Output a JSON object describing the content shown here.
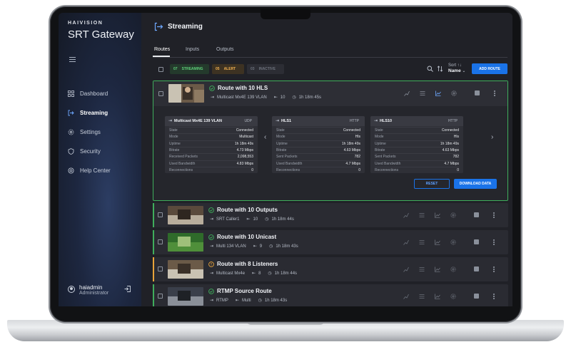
{
  "brand": {
    "top": "HAIVISION",
    "name": "SRT Gateway"
  },
  "sidebar": {
    "items": [
      {
        "label": "Dashboard",
        "icon": "dashboard-icon"
      },
      {
        "label": "Streaming",
        "icon": "streaming-icon",
        "active": true
      },
      {
        "label": "Settings",
        "icon": "gear-icon"
      },
      {
        "label": "Security",
        "icon": "shield-icon"
      },
      {
        "label": "Help Center",
        "icon": "help-icon"
      }
    ],
    "user": {
      "name": "haiadmin",
      "role": "Administrator"
    }
  },
  "page": {
    "title": "Streaming"
  },
  "tabs": [
    "Routes",
    "Inputs",
    "Outputs"
  ],
  "filters": {
    "streaming": {
      "count": "07",
      "label": "STREAMING"
    },
    "alert": {
      "count": "05",
      "label": "ALERT"
    },
    "inactive": {
      "count": "03",
      "label": "INACTIVE"
    }
  },
  "sort": {
    "label": "Sort ↑↓",
    "value": "Name"
  },
  "add_route_label": "ADD ROUTE",
  "expanded_route": {
    "name": "Route with 10 HLS",
    "source": "Multicast Mx4E 139 VLAN",
    "outputs": "10",
    "uptime": "1h 18m 45s",
    "panels": [
      {
        "title": "Multicast Mx4E 139 VLAN",
        "type": "UDP",
        "rows": [
          [
            "State",
            "Connected"
          ],
          [
            "Mode",
            "Multicast"
          ],
          [
            "Uptime",
            "1h 18m 49s"
          ],
          [
            "Bitrate",
            "4.73 Mbps"
          ],
          [
            "Received Packets",
            "2,098,553"
          ],
          [
            "Used Bandwidth",
            "4.83 Mbps"
          ],
          [
            "Reconnections",
            "0"
          ]
        ]
      },
      {
        "title": "HLS1",
        "type": "HTTP",
        "rows": [
          [
            "State",
            "Connected"
          ],
          [
            "Mode",
            "Hls"
          ],
          [
            "Uptime",
            "1h 18m 49s"
          ],
          [
            "Bitrate",
            "4.63 Mbps"
          ],
          [
            "Sent Packets",
            "782"
          ],
          [
            "Used Bandwidth",
            "4.7 Mbps"
          ],
          [
            "Reconnections",
            "0"
          ]
        ]
      },
      {
        "title": "HLS10",
        "type": "HTTP",
        "rows": [
          [
            "State",
            "Connected"
          ],
          [
            "Mode",
            "Hls"
          ],
          [
            "Uptime",
            "1h 18m 49s"
          ],
          [
            "Bitrate",
            "4.63 Mbps"
          ],
          [
            "Sent Packets",
            "782"
          ],
          [
            "Used Bandwidth",
            "4.7 Mbps"
          ],
          [
            "Reconnections",
            "0"
          ]
        ]
      }
    ],
    "reset_label": "RESET",
    "download_label": "DOWNLOAD DATA"
  },
  "routes": [
    {
      "name": "Route with 10 Outputs",
      "source": "SRT Caller1",
      "outputs": "10",
      "uptime": "1h 18m 44s",
      "status": "ok"
    },
    {
      "name": "Route with 10 Unicast",
      "source": "Multi 134 VLAN",
      "outputs": "9",
      "uptime": "1h 18m 43s",
      "status": "ok"
    },
    {
      "name": "Route with 8 Listeners",
      "source": "Multicast Mx4e",
      "outputs": "8",
      "uptime": "1h 18m 44s",
      "status": "alert"
    },
    {
      "name": "RTMP Source Route",
      "source": "RTMP",
      "outputs": "Multi",
      "uptime": "1h 18m 43s",
      "status": "ok"
    }
  ],
  "colors": {
    "accent_green": "#3fae5c",
    "accent_orange": "#e8a33a",
    "primary_blue": "#1a73e8"
  }
}
